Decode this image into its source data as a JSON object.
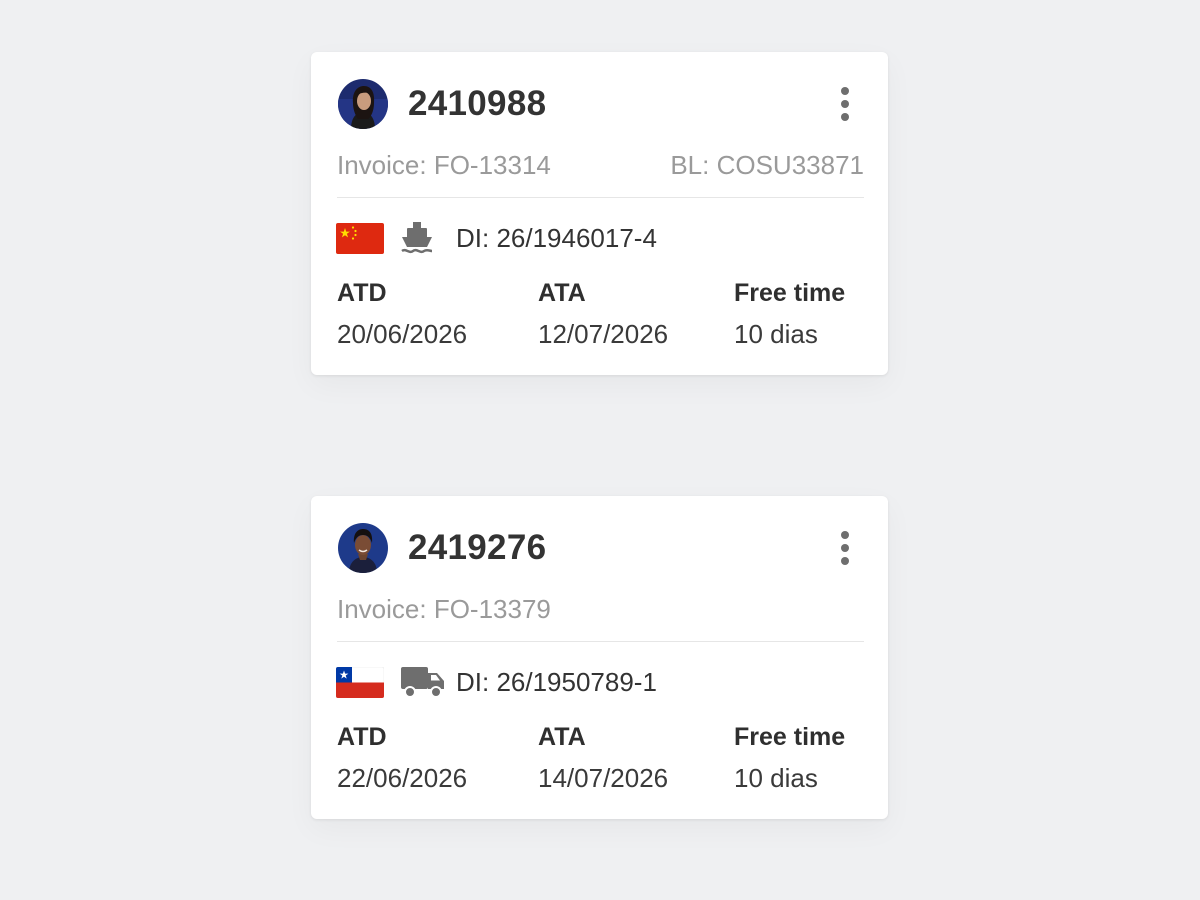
{
  "colors": {
    "background": "#eff0f2",
    "card": "#ffffff",
    "muted_text": "#9a9a9a",
    "icon_gray": "#6e6e6e"
  },
  "shipments": [
    {
      "id": "2410988",
      "avatar": "user-avatar-woman",
      "invoice": "Invoice: FO-13314",
      "bl": "BL: COSU33871",
      "origin_flag": "china-flag-icon",
      "transport_icon": "ship-icon",
      "di": "DI: 26/1946017-4",
      "atd_label": "ATD",
      "atd": "20/06/2026",
      "ata_label": "ATA",
      "ata": "12/07/2026",
      "free_time_label": "Free time",
      "free_time": "10 dias"
    },
    {
      "id": "2419276",
      "avatar": "user-avatar-man",
      "invoice": "Invoice: FO-13379",
      "bl": "",
      "origin_flag": "chile-flag-icon",
      "transport_icon": "truck-icon",
      "di": "DI: 26/1950789-1",
      "atd_label": "ATD",
      "atd": "22/06/2026",
      "ata_label": "ATA",
      "ata": "14/07/2026",
      "free_time_label": "Free time",
      "free_time": "10 dias"
    }
  ]
}
